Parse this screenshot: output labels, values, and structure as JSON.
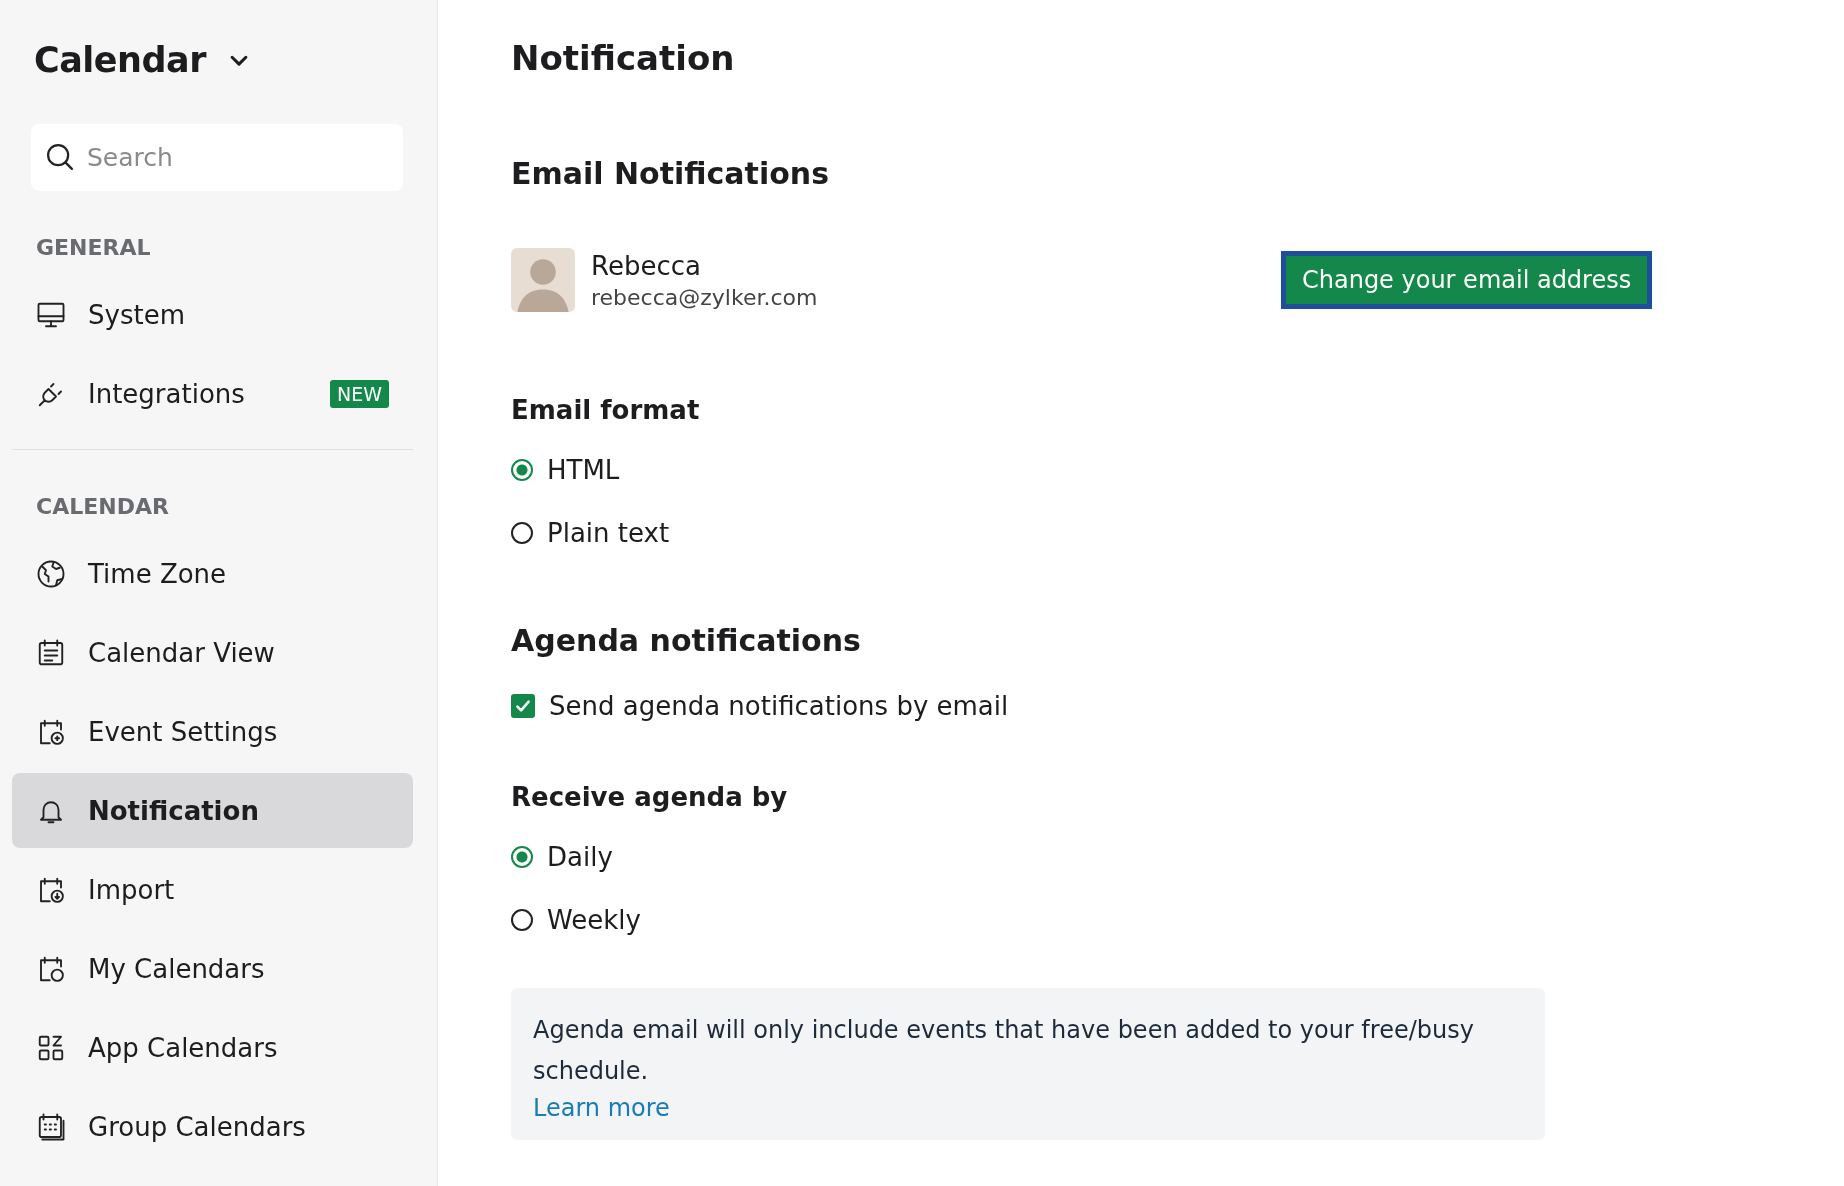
{
  "sidebar": {
    "title": "Calendar",
    "search": {
      "placeholder": "Search"
    },
    "sections": [
      {
        "heading": "GENERAL",
        "items": [
          {
            "label": "System",
            "selected": false
          },
          {
            "label": "Integrations",
            "selected": false,
            "badge": "NEW"
          }
        ]
      },
      {
        "heading": "CALENDAR",
        "items": [
          {
            "label": "Time Zone",
            "selected": false
          },
          {
            "label": "Calendar View",
            "selected": false
          },
          {
            "label": "Event Settings",
            "selected": false
          },
          {
            "label": "Notification",
            "selected": true
          },
          {
            "label": "Import",
            "selected": false
          },
          {
            "label": "My Calendars",
            "selected": false
          },
          {
            "label": "App Calendars",
            "selected": false
          },
          {
            "label": "Group Calendars",
            "selected": false
          }
        ]
      }
    ]
  },
  "page": {
    "title": "Notification",
    "email_notifications": {
      "heading": "Email Notifications",
      "user": {
        "name": "Rebecca",
        "email": "rebecca@zylker.com"
      },
      "change_button": "Change your email address"
    },
    "email_format": {
      "heading": "Email format",
      "options": [
        {
          "label": "HTML",
          "selected": true
        },
        {
          "label": "Plain text",
          "selected": false
        }
      ]
    },
    "agenda": {
      "heading": "Agenda notifications",
      "checkbox": {
        "label": "Send agenda notifications by email",
        "checked": true
      },
      "receive_heading": "Receive agenda by",
      "options": [
        {
          "label": "Daily",
          "selected": true
        },
        {
          "label": "Weekly",
          "selected": false
        }
      ],
      "info": {
        "text": "Agenda email will only include events that have been added to your free/busy schedule.",
        "link": "Learn more"
      }
    }
  }
}
